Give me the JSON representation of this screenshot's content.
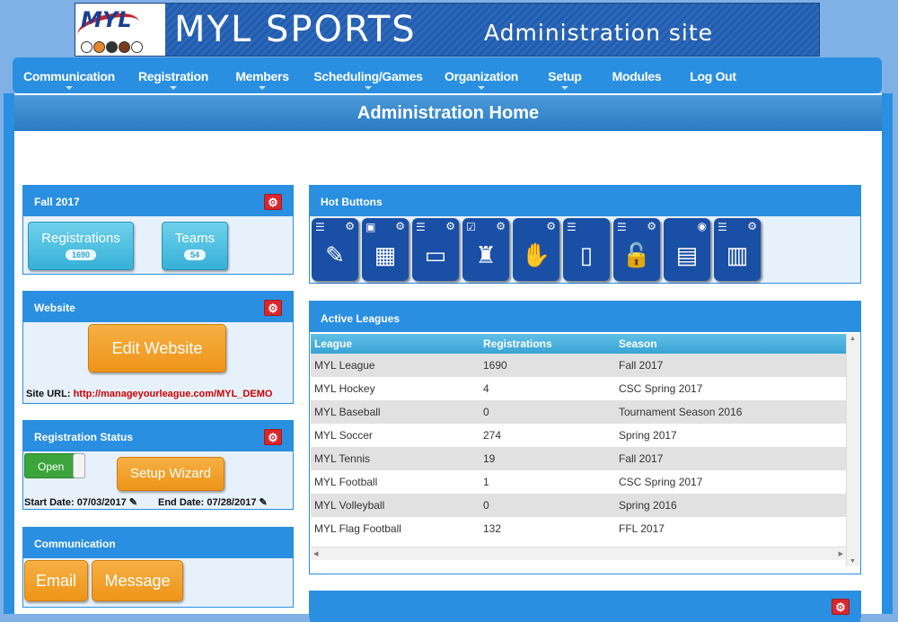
{
  "banner": {
    "logo_text": "MYL",
    "title": "MYL SPORTS",
    "subtitle": "Administration site"
  },
  "nav": {
    "items": [
      {
        "label": "Communication",
        "has_dropdown": true
      },
      {
        "label": "Registration",
        "has_dropdown": true
      },
      {
        "label": "Members",
        "has_dropdown": true
      },
      {
        "label": "Scheduling/Games",
        "has_dropdown": true
      },
      {
        "label": "Organization",
        "has_dropdown": true
      },
      {
        "label": "Setup",
        "has_dropdown": true
      },
      {
        "label": "Modules",
        "has_dropdown": false
      },
      {
        "label": "Log Out",
        "has_dropdown": false
      }
    ]
  },
  "page": {
    "title": "Administration Home"
  },
  "season_panel": {
    "title": "Fall 2017",
    "registrations": {
      "label": "Registrations",
      "count": "1690"
    },
    "teams": {
      "label": "Teams",
      "count": "54"
    }
  },
  "website_panel": {
    "title": "Website",
    "edit_label": "Edit Website",
    "site_url_label": "Site URL:",
    "site_url": "http://manageyourleague.com/MYL_DEMO"
  },
  "registration_status": {
    "title": "Registration Status",
    "toggle_label": "Open",
    "toggle_on": true,
    "wizard_label": "Setup Wizard",
    "start_date_label": "Start Date:",
    "start_date": "07/03/2017",
    "end_date_label": "End Date:",
    "end_date": "07/28/2017"
  },
  "communication_panel": {
    "title": "Communication",
    "email_label": "Email",
    "message_label": "Message"
  },
  "hot_buttons": {
    "title": "Hot Buttons",
    "buttons": [
      {
        "icon": "edit-form-icon",
        "glyph": "✎",
        "menu": "☰",
        "cog": "⚙"
      },
      {
        "icon": "calendar-clock-icon",
        "glyph": "▦",
        "menu": "▣",
        "cog": "⚙"
      },
      {
        "icon": "basketball-court-icon",
        "glyph": "▭",
        "menu": "☰",
        "cog": "⚙"
      },
      {
        "icon": "referee-icon",
        "glyph": "♜",
        "menu": "☑",
        "cog": "⚙"
      },
      {
        "icon": "raised-hand-icon",
        "glyph": "✋",
        "menu": "",
        "cog": "⚙"
      },
      {
        "icon": "id-badge-icon",
        "glyph": "▯",
        "menu": "☰",
        "cog": ""
      },
      {
        "icon": "unlock-icon",
        "glyph": "🔓",
        "menu": "☰",
        "cog": "⚙"
      },
      {
        "icon": "document-icon",
        "glyph": "▤",
        "menu": "",
        "cog": "◉"
      },
      {
        "icon": "scoreboard-icon",
        "glyph": "▥",
        "menu": "☰",
        "cog": "⚙"
      }
    ]
  },
  "active_leagues": {
    "title": "Active Leagues",
    "columns": [
      "League",
      "Registrations",
      "Season"
    ],
    "rows": [
      [
        "MYL League",
        "1690",
        "Fall 2017"
      ],
      [
        "MYL Hockey",
        "4",
        "CSC Spring 2017"
      ],
      [
        "MYL Baseball",
        "0",
        "Tournament Season 2016"
      ],
      [
        "MYL Soccer",
        "274",
        "Spring 2017"
      ],
      [
        "MYL Tennis",
        "19",
        "Fall 2017"
      ],
      [
        "MYL Football",
        "1",
        "CSC Spring 2017"
      ],
      [
        "MYL Volleyball",
        "0",
        "Spring 2016"
      ],
      [
        "MYL Flag Football",
        "132",
        "FFL 2017"
      ]
    ]
  },
  "colors": {
    "accent": "#2a8fe0",
    "hot_button": "#1a4fa6",
    "orange": "#f2a02c",
    "teal": "#4cc0e2",
    "danger": "#d9272e"
  }
}
